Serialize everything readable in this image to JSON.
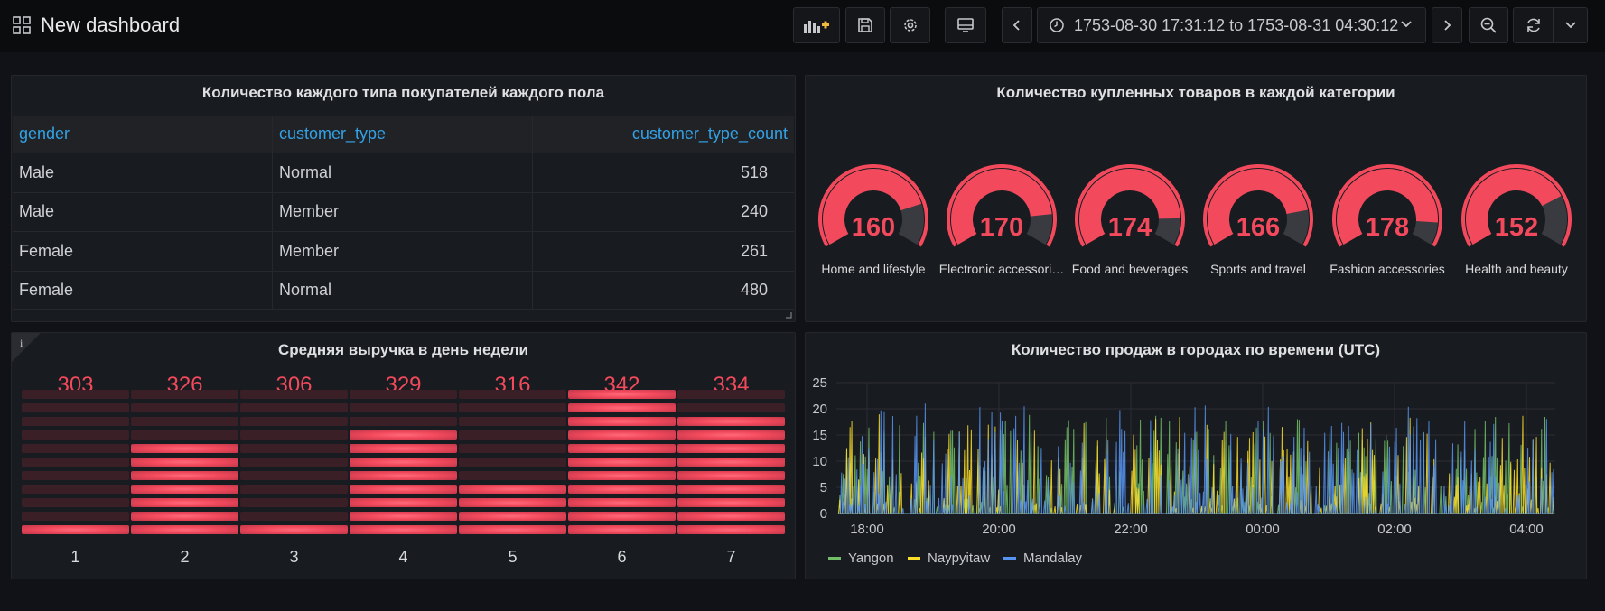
{
  "header": {
    "title": "New dashboard",
    "time_range": "1753-08-30 17:31:12 to 1753-08-31 04:30:12",
    "icons": [
      "grid-icon",
      "add-panel-icon",
      "save-icon",
      "settings-icon",
      "tv-icon",
      "chevron-left-icon",
      "clock-icon",
      "chevron-down-icon",
      "chevron-right-icon",
      "zoom-out-icon",
      "refresh-icon",
      "chevron-down-icon"
    ]
  },
  "table_panel": {
    "title": "Количество каждого типа покупателей каждого пола",
    "columns": [
      "gender",
      "customer_type",
      "customer_type_count"
    ],
    "rows": [
      [
        "Male",
        "Normal",
        "518"
      ],
      [
        "Male",
        "Member",
        "240"
      ],
      [
        "Female",
        "Member",
        "261"
      ],
      [
        "Female",
        "Normal",
        "480"
      ]
    ]
  },
  "gauge_panel": {
    "title": "Количество купленных товаров в каждой категории",
    "max": 200,
    "color": "#f2495c",
    "gauges": [
      {
        "value": "160",
        "label": "Home and lifestyle"
      },
      {
        "value": "170",
        "label": "Electronic accessori…"
      },
      {
        "value": "174",
        "label": "Food and beverages"
      },
      {
        "value": "166",
        "label": "Sports and travel"
      },
      {
        "value": "178",
        "label": "Fashion accessories"
      },
      {
        "value": "152",
        "label": "Health and beauty"
      }
    ]
  },
  "bar_panel": {
    "title": "Средняя выручка в день недели",
    "info_icon": "i",
    "color": "#f2495c",
    "days": [
      {
        "label": "1",
        "value": "303",
        "lit": 1
      },
      {
        "label": "2",
        "value": "326",
        "lit": 7
      },
      {
        "label": "3",
        "value": "306",
        "lit": 1
      },
      {
        "label": "4",
        "value": "329",
        "lit": 8
      },
      {
        "label": "5",
        "value": "316",
        "lit": 4
      },
      {
        "label": "6",
        "value": "342",
        "lit": 11
      },
      {
        "label": "7",
        "value": "334",
        "lit": 9
      }
    ]
  },
  "timeseries_panel": {
    "title": "Количество продаж в городах по времени (UTC)",
    "legend": [
      {
        "name": "Yangon",
        "color": "#73bf69"
      },
      {
        "name": "Naypyitaw",
        "color": "#fade2a"
      },
      {
        "name": "Mandalay",
        "color": "#5794f2"
      }
    ]
  },
  "chart_data": {
    "type": "line",
    "title": "Количество продаж в городах по времени (UTC)",
    "x_ticks": [
      "18:00",
      "20:00",
      "22:00",
      "00:00",
      "02:00",
      "04:00"
    ],
    "y_ticks": [
      "0",
      "5",
      "10",
      "15",
      "20",
      "25"
    ],
    "ylim": [
      0,
      25
    ],
    "grid": true,
    "legend_position": "bottom-left",
    "series": [
      {
        "name": "Yangon"
      },
      {
        "name": "Naypyitaw"
      },
      {
        "name": "Mandalay"
      }
    ]
  }
}
